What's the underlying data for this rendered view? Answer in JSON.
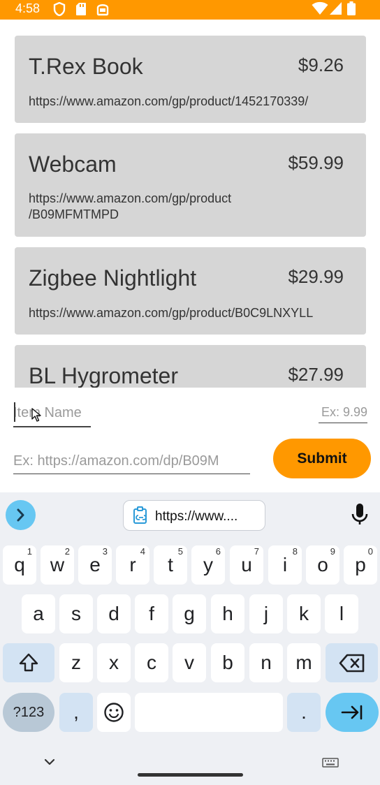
{
  "status_bar": {
    "time": "4:58",
    "background": "#FF9800",
    "left_icons": [
      "shield-icon",
      "sd-card-icon",
      "toast-icon"
    ],
    "right_icons": [
      "wifi-icon",
      "signal-icon",
      "battery-icon"
    ]
  },
  "items": [
    {
      "name": "T.Rex Book",
      "price": "$9.26",
      "url": "https://www.amazon.com/gp/product/1452170339/"
    },
    {
      "name": "Webcam",
      "price": "$59.99",
      "url_lines": [
        "https://www.amazon.com/gp/product",
        "/B09MFMTMPD"
      ]
    },
    {
      "name": "Zigbee Nightlight",
      "price": "$29.99",
      "url": "https://www.amazon.com/gp/product/B0C9LNXYLL"
    },
    {
      "name": "BL Hygrometer",
      "price": "$27.99"
    }
  ],
  "form": {
    "name_placeholder": "Item Name",
    "price_placeholder": "Ex: 9.99",
    "url_placeholder": "Ex: https://amazon.com/dp/B09M",
    "submit_label": "Submit",
    "accent": "#FF9800"
  },
  "keyboard": {
    "clipboard_preview": "https://www....",
    "row1": [
      {
        "key": "q",
        "hint": "1"
      },
      {
        "key": "w",
        "hint": "2"
      },
      {
        "key": "e",
        "hint": "3"
      },
      {
        "key": "r",
        "hint": "4"
      },
      {
        "key": "t",
        "hint": "5"
      },
      {
        "key": "y",
        "hint": "6"
      },
      {
        "key": "u",
        "hint": "7"
      },
      {
        "key": "i",
        "hint": "8"
      },
      {
        "key": "o",
        "hint": "9"
      },
      {
        "key": "p",
        "hint": "0"
      }
    ],
    "row2": [
      "a",
      "s",
      "d",
      "f",
      "g",
      "h",
      "j",
      "k",
      "l"
    ],
    "row3": [
      "z",
      "x",
      "c",
      "v",
      "b",
      "n",
      "m"
    ],
    "symbols_label": "?123",
    "comma": ",",
    "period": ".",
    "accent": "#67c7f2"
  }
}
